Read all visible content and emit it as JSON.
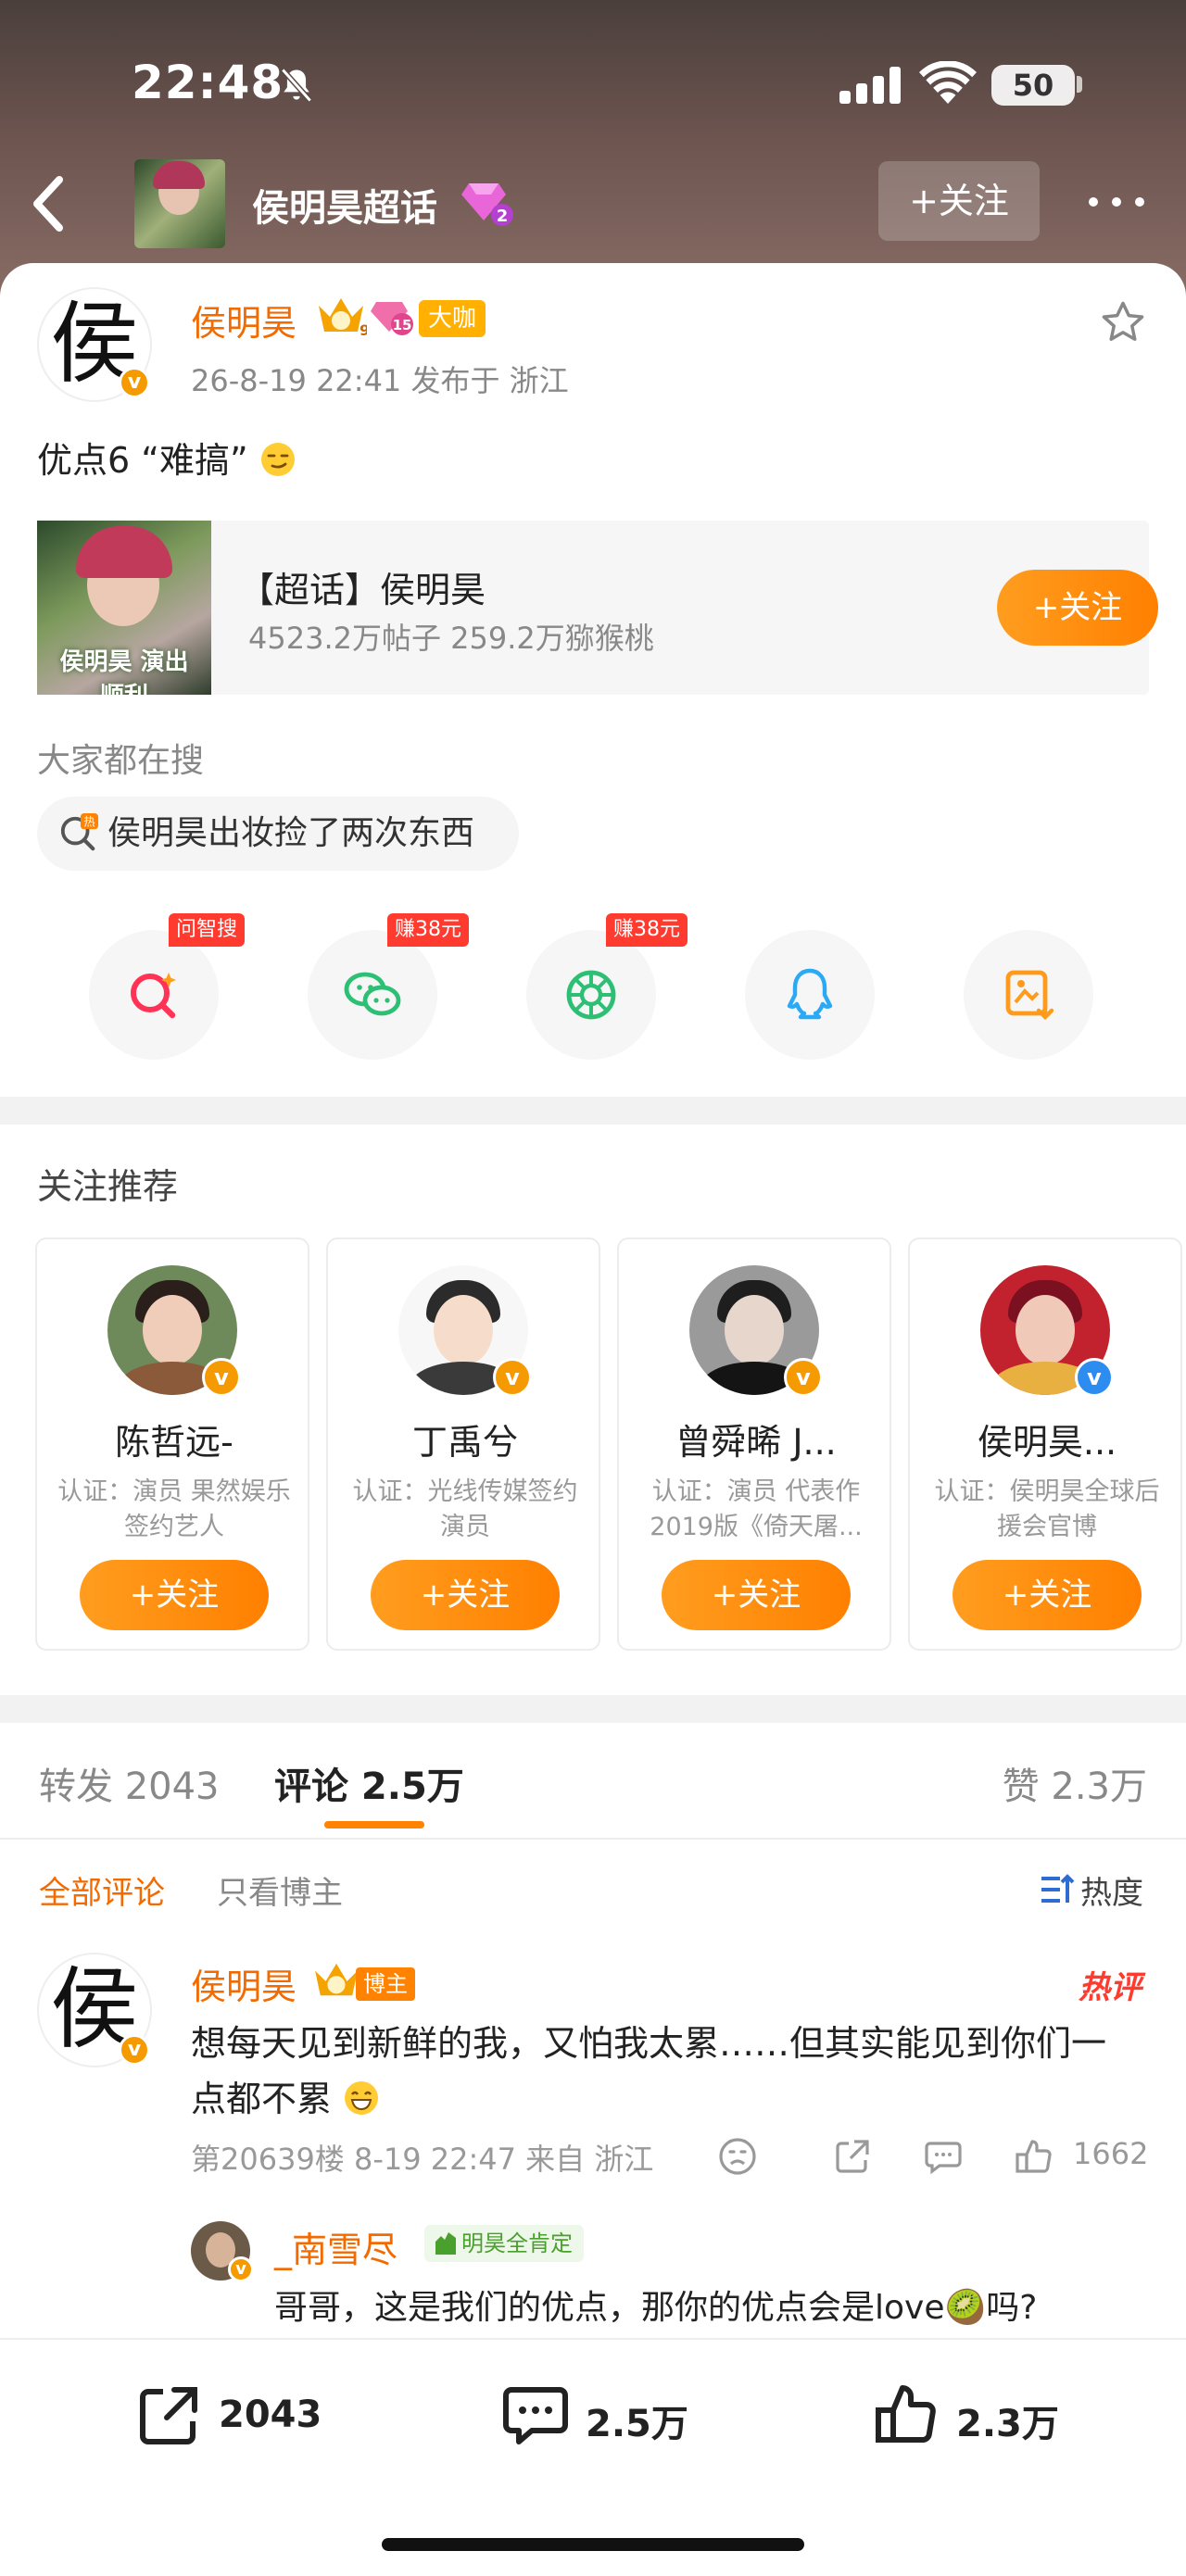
{
  "status_bar": {
    "time": "22:48",
    "battery": "50"
  },
  "header": {
    "topic_title": "侯明昊超话",
    "follow_label": "+关注"
  },
  "post": {
    "author_avatar_char": "侯",
    "author": "侯明昊",
    "big_badge": "大咖",
    "level": "15",
    "crown_level": "9",
    "meta": "26-8-19 22:41 发布于 浙江",
    "text": "优点6 “难搞”",
    "supertopic": {
      "title": "【超话】侯明昊",
      "stats": "4523.2万帖子 259.2万猕猴桃",
      "follow_label": "+关注",
      "thumb_caption": "侯明昊 演出顺利"
    },
    "hot_search_label": "大家都在搜",
    "hot_search_item": "侯明昊出妆捡了两次东西",
    "share_tags": [
      "问智搜",
      "赚38元",
      "赚38元"
    ]
  },
  "recommend": {
    "title": "关注推荐",
    "cards": [
      {
        "name": "陈哲远-",
        "desc": "认证：演员 果然娱乐签约艺人",
        "follow": "+关注",
        "verify_color": "#f59a00"
      },
      {
        "name": "丁禹兮",
        "desc": "认证：光线传媒签约演员",
        "follow": "+关注",
        "verify_color": "#f59a00"
      },
      {
        "name": "曾舜晞 J...",
        "desc": "认证：演员 代表作2019版《倚天屠...",
        "follow": "+关注",
        "verify_color": "#f59a00"
      },
      {
        "name": "侯明昊...",
        "desc": "认证：侯明昊全球后援会官博",
        "follow": "+关注",
        "verify_color": "#2d8cf0"
      }
    ]
  },
  "tabs": {
    "repost": "转发 2043",
    "comment": "评论 2.5万",
    "like": "赞 2.3万"
  },
  "comment_filters": {
    "all": "全部评论",
    "author_only": "只看博主",
    "sort": "热度"
  },
  "comment": {
    "avatar_char": "侯",
    "author": "侯明昊",
    "author_tag": "博主",
    "hot_tag": "热评",
    "text": "想每天见到新鲜的我，又怕我太累……但其实能见到你们一点都不累",
    "meta": "第20639楼 8-19 22:47 来自 浙江",
    "like_count": "1662",
    "reply": {
      "author": "_南雪尽",
      "tag": "明昊全肯定",
      "text": "哥哥，这是我们的优点，那你的优点会是love🥝吗?"
    }
  },
  "bottom_bar": {
    "repost": "2043",
    "comment": "2.5万",
    "like": "2.3万"
  },
  "colors": {
    "accent": "#ff8200",
    "name_orange": "#f26a00",
    "hot_red": "#ff3b30"
  }
}
